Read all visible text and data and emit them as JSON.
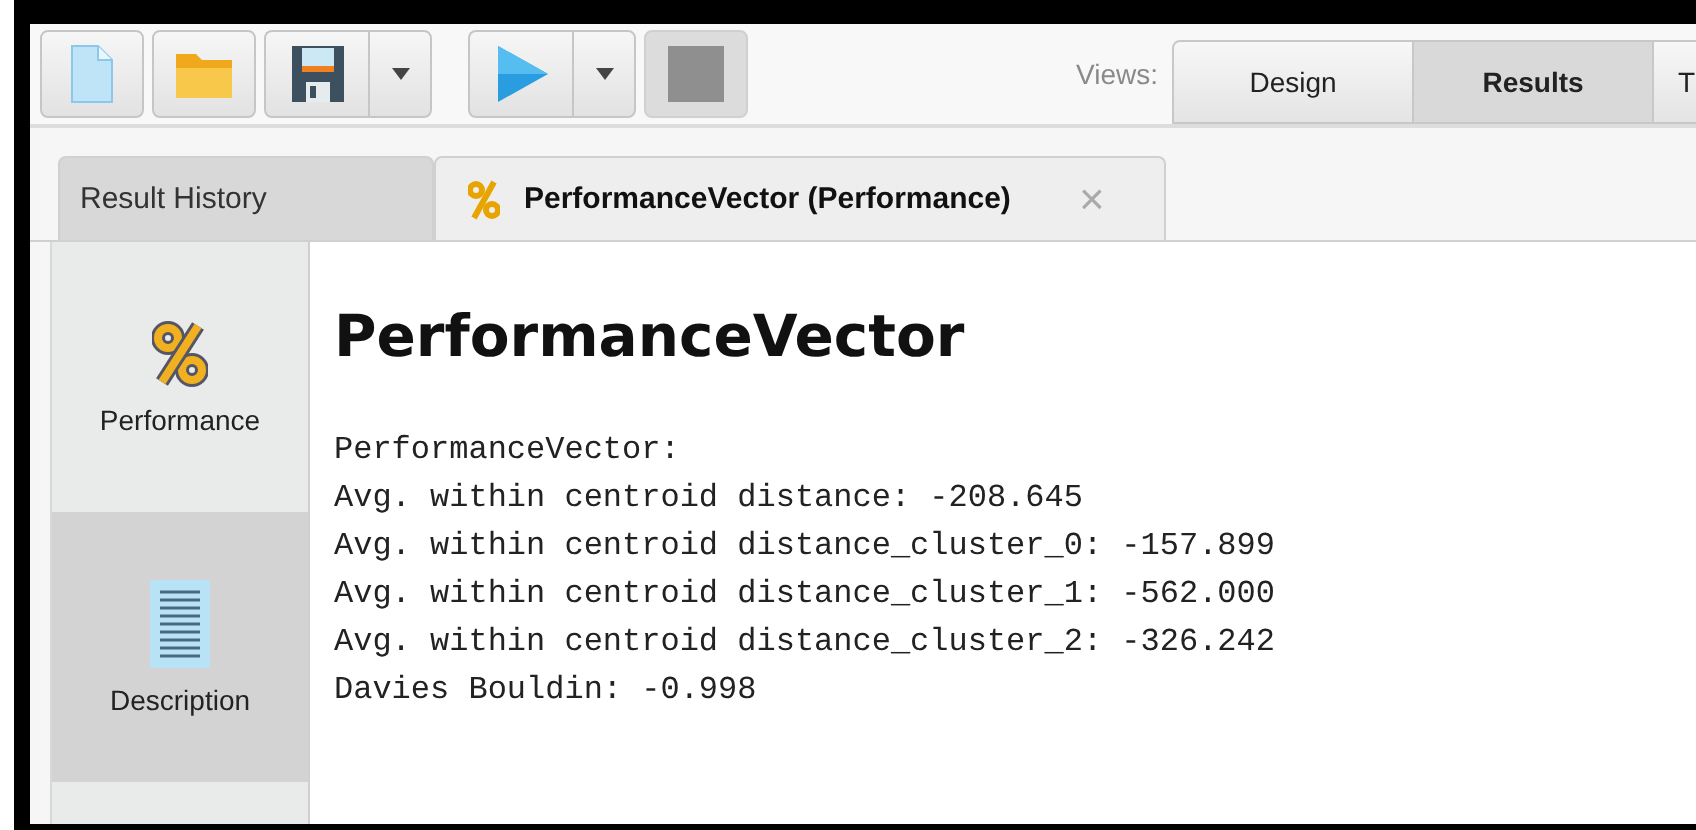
{
  "toolbar": {
    "buttons": [
      {
        "kind": "new",
        "disabled": false,
        "dropdown": false
      },
      {
        "kind": "open",
        "disabled": false,
        "dropdown": false
      },
      {
        "kind": "save",
        "disabled": false,
        "dropdown": true
      },
      {
        "kind": "run",
        "disabled": false,
        "dropdown": true
      },
      {
        "kind": "stop",
        "disabled": true,
        "dropdown": false
      }
    ],
    "views_label": "Views:",
    "views": [
      {
        "label": "Design",
        "selected": false
      },
      {
        "label": "Results",
        "selected": true
      },
      {
        "label": "T",
        "selected": false
      }
    ]
  },
  "tabs": [
    {
      "label": "Result History",
      "selected": false,
      "icon": false
    },
    {
      "label": "PerformanceVector (Performance)",
      "selected": true,
      "icon": true,
      "close": "×"
    }
  ],
  "sidebar": {
    "items": [
      {
        "label": "Performance",
        "kind": "percent",
        "selected": true
      },
      {
        "label": "Description",
        "kind": "document",
        "selected": false
      }
    ]
  },
  "content": {
    "heading": "PerformanceVector",
    "lines": [
      "PerformanceVector:",
      "Avg. within centroid distance: -208.645",
      "Avg. within centroid distance_cluster_0: -157.899",
      "Avg. within centroid distance_cluster_1: -562.000",
      "Avg. within centroid distance_cluster_2: -326.242",
      "Davies Bouldin: -0.998"
    ]
  }
}
